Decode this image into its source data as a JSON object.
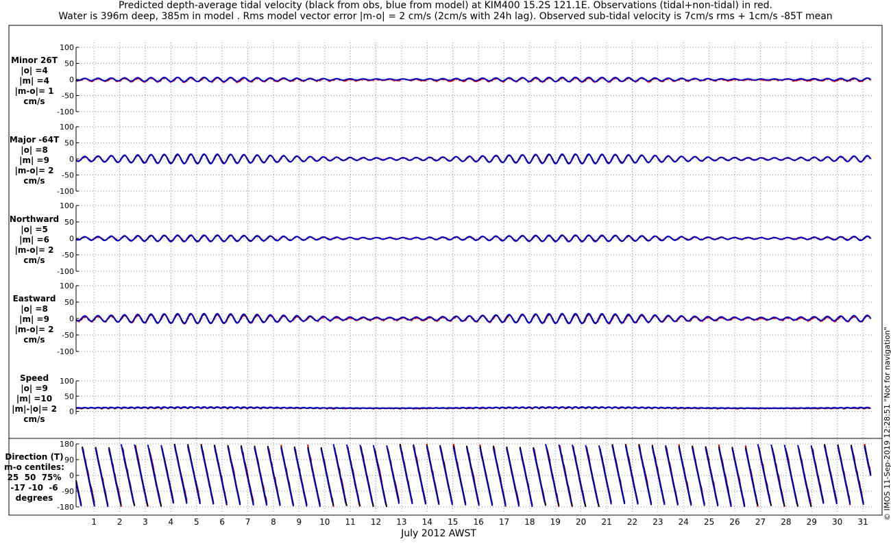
{
  "title": {
    "line1": "Predicted depth-average tidal velocity (black from obs, blue from model) at KIM400 15.2S 121.1E. Observations (tidal+non-tidal) in red.",
    "line2": "Water is 396m deep, 385m in model . Rms model vector error |m-o| = 2 cm/s (2cm/s with 24h lag). Observed sub-tidal velocity is 7cm/s rms + 1cm/s -85T mean"
  },
  "x_axis": {
    "label": "July 2012 AWST",
    "tick_labels": [
      "1",
      "2",
      "3",
      "4",
      "5",
      "6",
      "7",
      "8",
      "9",
      "10",
      "11",
      "12",
      "13",
      "14",
      "15",
      "16",
      "17",
      "18",
      "19",
      "20",
      "21",
      "22",
      "23",
      "24",
      "25",
      "26",
      "27",
      "28",
      "29",
      "30",
      "31"
    ]
  },
  "watermark": "© IMOS 11-Sep-2019 12:28:51  \"Not for navigation\"",
  "colors": {
    "obs": "#ff0000",
    "tidal_obs": "#000000",
    "model": "#0000cc",
    "grid": "#888888"
  },
  "chart_data": [
    {
      "type": "line",
      "panel": "Minor 26T",
      "label_lines": [
        "Minor 26T",
        "|o| =4",
        "|m| =4",
        "|m-o|= 1",
        "cm/s"
      ],
      "ylim": [
        -100,
        100
      ],
      "y_tick_labels": [
        "100",
        "50",
        "0",
        "-50",
        "-100"
      ],
      "xlim": [
        0.3,
        31.4
      ],
      "series": [
        {
          "role": "obs",
          "rms_amplitude": 4,
          "mean": -2,
          "period_hours": 12.42
        },
        {
          "role": "tidal_obs",
          "rms_amplitude": 4,
          "mean": 0,
          "period_hours": 12.42
        },
        {
          "role": "model",
          "rms_amplitude": 4,
          "mean": 0,
          "period_hours": 12.42
        }
      ]
    },
    {
      "type": "line",
      "panel": "Major -64T",
      "label_lines": [
        "Major -64T",
        "|o| =8",
        "|m| =9",
        "|m-o|= 2",
        "cm/s"
      ],
      "ylim": [
        -100,
        100
      ],
      "y_tick_labels": [
        "100",
        "50",
        "0",
        "-50",
        "-100"
      ],
      "xlim": [
        0.3,
        31.4
      ],
      "series": [
        {
          "role": "obs",
          "rms_amplitude": 8,
          "mean": 0,
          "period_hours": 12.42
        },
        {
          "role": "tidal_obs",
          "rms_amplitude": 8,
          "mean": 0,
          "period_hours": 12.42
        },
        {
          "role": "model",
          "rms_amplitude": 9,
          "mean": 0,
          "period_hours": 12.42
        }
      ]
    },
    {
      "type": "line",
      "panel": "Northward",
      "label_lines": [
        "Northward",
        "|o| =5",
        "|m| =6",
        "|m-o|= 2",
        "cm/s"
      ],
      "ylim": [
        -100,
        100
      ],
      "y_tick_labels": [
        "100",
        "50",
        "0",
        "-50",
        "-100"
      ],
      "xlim": [
        0.3,
        31.4
      ],
      "series": [
        {
          "role": "obs",
          "rms_amplitude": 5,
          "mean": 0,
          "period_hours": 12.42
        },
        {
          "role": "tidal_obs",
          "rms_amplitude": 5,
          "mean": 0,
          "period_hours": 12.42
        },
        {
          "role": "model",
          "rms_amplitude": 6,
          "mean": 0,
          "period_hours": 12.42
        }
      ]
    },
    {
      "type": "line",
      "panel": "Eastward",
      "label_lines": [
        "Eastward",
        "|o| =8",
        "|m| =9",
        "|m-o|= 2",
        "cm/s"
      ],
      "ylim": [
        -100,
        100
      ],
      "y_tick_labels": [
        "100",
        "50",
        "0",
        "-50",
        "-100"
      ],
      "xlim": [
        0.3,
        31.4
      ],
      "series": [
        {
          "role": "obs",
          "rms_amplitude": 8,
          "mean": -2,
          "period_hours": 12.42
        },
        {
          "role": "tidal_obs",
          "rms_amplitude": 8,
          "mean": 0,
          "period_hours": 12.42
        },
        {
          "role": "model",
          "rms_amplitude": 9,
          "mean": 0,
          "period_hours": 12.42
        }
      ]
    },
    {
      "type": "line",
      "panel": "Speed",
      "label_lines": [
        "Speed",
        "|o| =9",
        "|m| =10",
        "|m|-|o|= 2",
        "cm/s"
      ],
      "ylim": [
        -10,
        100
      ],
      "y_tick_labels": [
        "100",
        "50",
        "0"
      ],
      "xlim": [
        0.3,
        31.4
      ],
      "series": [
        {
          "role": "obs",
          "rms_amplitude": 9,
          "mean": 9,
          "period_hours": 6.21
        },
        {
          "role": "tidal_obs",
          "rms_amplitude": 9,
          "mean": 9,
          "period_hours": 6.21
        },
        {
          "role": "model",
          "rms_amplitude": 10,
          "mean": 10,
          "period_hours": 6.21
        }
      ]
    },
    {
      "type": "scatter",
      "panel": "Direction (T)",
      "label_lines": [
        "Direction (T)",
        "m-o centiles:",
        "25  50  75%",
        "-17 -10  -6",
        "degrees"
      ],
      "ylim": [
        -180,
        180
      ],
      "y_tick_labels": [
        "180",
        "90",
        "0",
        "-90",
        "-180"
      ],
      "xlim": [
        0.3,
        31.4
      ],
      "centiles": {
        "p25": -17,
        "p50": -10,
        "p75": -6
      },
      "series": [
        {
          "role": "obs",
          "period_hours": 12.42
        },
        {
          "role": "tidal_obs",
          "period_hours": 12.42
        },
        {
          "role": "model",
          "period_hours": 12.42
        }
      ]
    }
  ]
}
